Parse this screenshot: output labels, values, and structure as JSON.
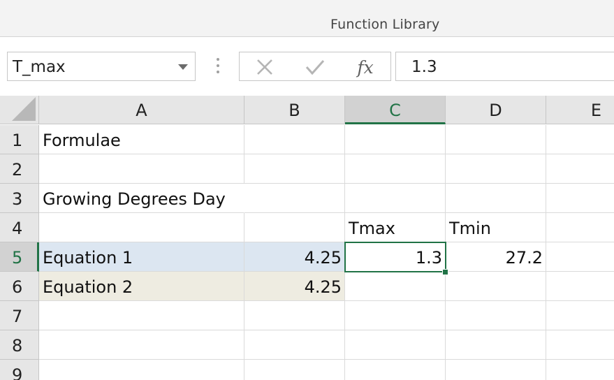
{
  "ribbon": {
    "group_label": "Function Library"
  },
  "formula_bar": {
    "name_box_value": "T_max",
    "cancel_icon": "close-icon",
    "enter_icon": "checkmark-icon",
    "fx_label": "fx",
    "formula_value": "1.3"
  },
  "grid": {
    "columns": [
      "A",
      "B",
      "C",
      "D",
      "E"
    ],
    "selected_column": "C",
    "rows": [
      "1",
      "2",
      "3",
      "4",
      "5",
      "6",
      "7",
      "8",
      "9"
    ],
    "selected_row": "5",
    "cells": {
      "A1": "Formulae",
      "A3": "Growing Degrees Day",
      "C4": "Tmax",
      "D4": "Tmin",
      "A5": "Equation 1",
      "B5": "4.25",
      "C5": "1.3",
      "D5": "27.2",
      "A6": "Equation 2",
      "B6": "4.25"
    },
    "active_cell": "C5"
  },
  "colors": {
    "excel_green": "#217346",
    "fill_blue": "#dce6f1",
    "fill_tan": "#eeece1"
  }
}
